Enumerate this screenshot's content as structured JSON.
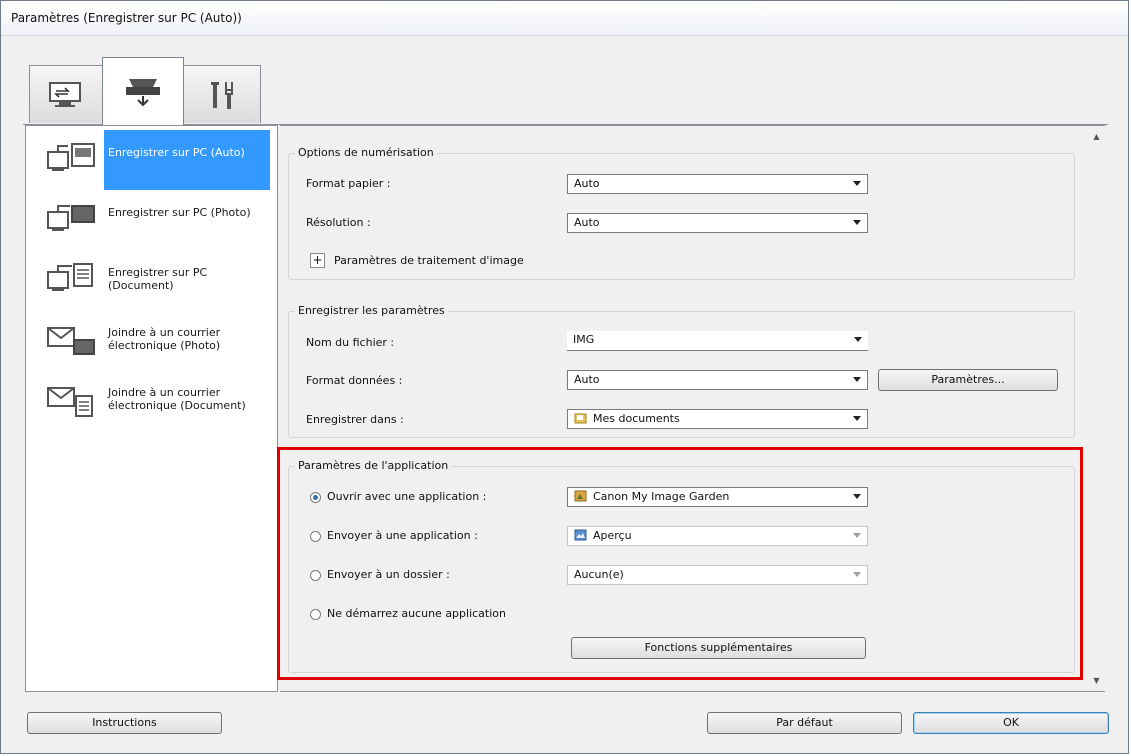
{
  "window": {
    "title": "Paramètres (Enregistrer sur PC (Auto))"
  },
  "tabs": [
    {
      "icon": "computer-scan-icon"
    },
    {
      "icon": "scanner-icon",
      "active": true
    },
    {
      "icon": "tools-icon"
    }
  ],
  "left_list": [
    {
      "label": "Enregistrer sur PC (Auto)",
      "icon": "save-pc-auto-icon",
      "selected": true
    },
    {
      "label": "Enregistrer sur PC (Photo)",
      "icon": "save-pc-photo-icon"
    },
    {
      "label": "Enregistrer sur PC (Document)",
      "icon": "save-pc-document-icon"
    },
    {
      "label": "Joindre à un courrier électronique (Photo)",
      "icon": "email-photo-icon"
    },
    {
      "label": "Joindre à un courrier électronique (Document)",
      "icon": "email-document-icon"
    }
  ],
  "scan_options": {
    "title": "Options de numérisation",
    "paper_format_label": "Format papier :",
    "paper_format_value": "Auto",
    "resolution_label": "Résolution :",
    "resolution_value": "Auto",
    "image_processing_label": "Paramètres de traitement d'image"
  },
  "save_settings": {
    "title": "Enregistrer les paramètres",
    "filename_label": "Nom du fichier :",
    "filename_value": "IMG",
    "data_format_label": "Format données :",
    "data_format_value": "Auto",
    "settings_button": "Paramètres...",
    "save_in_label": "Enregistrer dans :",
    "save_in_value": "Mes documents"
  },
  "app_settings": {
    "title": "Paramètres de l'application",
    "open_with_label": "Ouvrir avec une application :",
    "open_with_value": "Canon My Image Garden",
    "send_to_app_label": "Envoyer à une application :",
    "send_to_app_value": "Aperçu",
    "send_to_folder_label": "Envoyer à un dossier :",
    "send_to_folder_value": "Aucun(e)",
    "no_app_label": "Ne démarrez aucune application",
    "more_functions_button": "Fonctions supplémentaires"
  },
  "footer": {
    "instructions_button": "Instructions",
    "default_button": "Par défaut",
    "ok_button": "OK"
  },
  "colors": {
    "selection": "#3399ff",
    "highlight": "#e00000"
  }
}
